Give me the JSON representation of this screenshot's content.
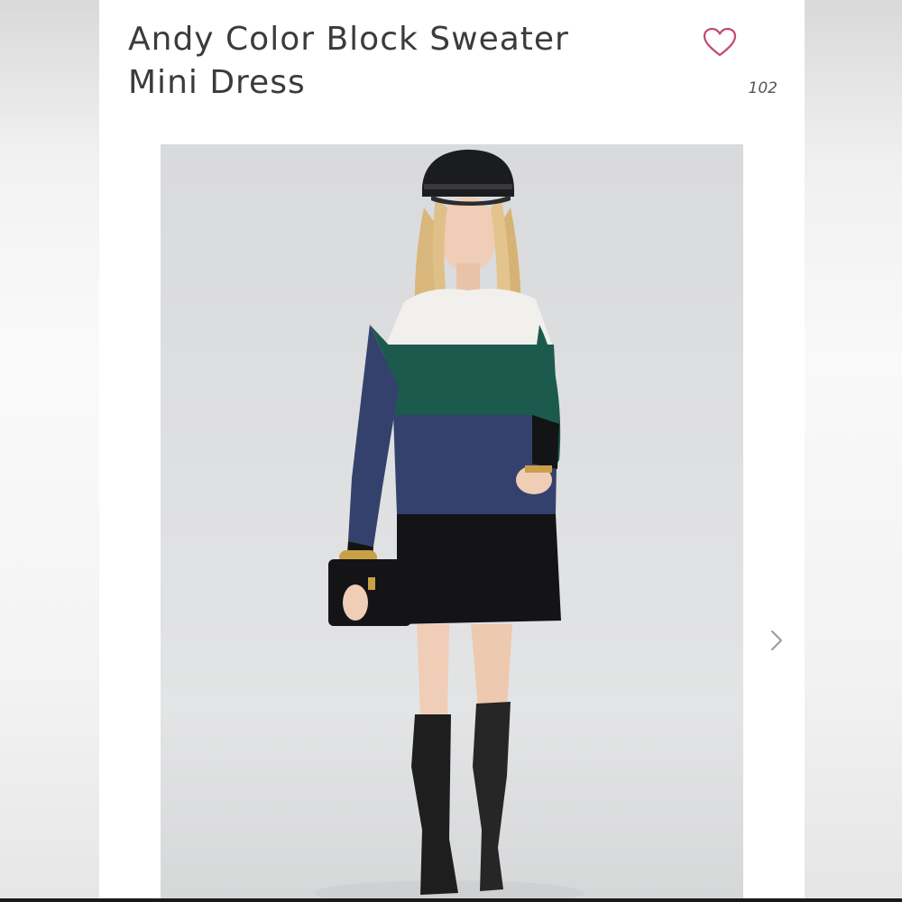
{
  "product": {
    "title_line1": "Andy Color Block Sweater",
    "title_line2": "Mini Dress",
    "like_count": "102",
    "like_icon": "heart-outline-icon",
    "next_icon": "chevron-right-icon"
  },
  "colors": {
    "heart": "#c2487a",
    "title_text": "#3b3b3b",
    "photo_bg": "#dedfe1",
    "sweater_white": "#f1f0ec",
    "sweater_green": "#1c5a4d",
    "sweater_navy": "#35416d",
    "sweater_black": "#141416"
  }
}
